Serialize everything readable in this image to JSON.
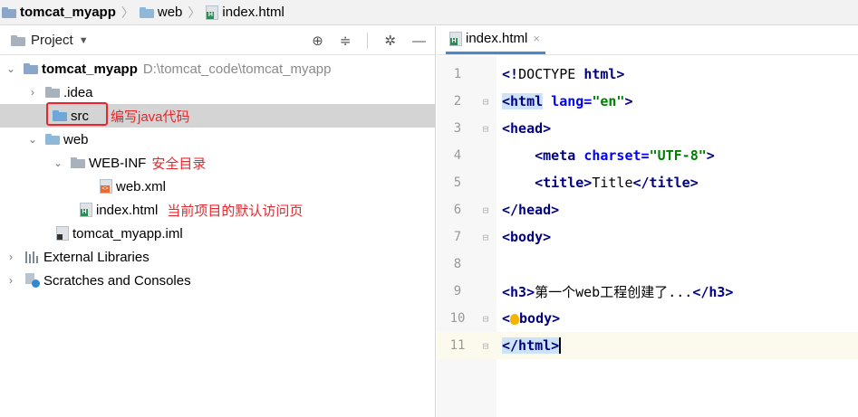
{
  "breadcrumb": {
    "project": "tomcat_myapp",
    "folder": "web",
    "file": "index.html"
  },
  "project_panel": {
    "title": "Project",
    "tree": [
      {
        "label": "tomcat_myapp",
        "path": "D:\\tomcat_code\\tomcat_myapp",
        "icon": "project-folder-icon",
        "expanded": true
      },
      {
        "label": ".idea",
        "icon": "folder-icon",
        "expanded": false
      },
      {
        "label": "src",
        "icon": "source-folder-icon",
        "annotation": "编写java代码",
        "selected": true
      },
      {
        "label": "web",
        "icon": "web-folder-icon",
        "expanded": true
      },
      {
        "label": "WEB-INF",
        "icon": "folder-icon",
        "annotation": "安全目录",
        "expanded": true
      },
      {
        "label": "web.xml",
        "icon": "xml-file-icon"
      },
      {
        "label": "index.html",
        "icon": "html-file-icon",
        "annotation": "当前项目的默认访问页"
      },
      {
        "label": "tomcat_myapp.iml",
        "icon": "iml-file-icon"
      },
      {
        "label": "External Libraries",
        "icon": "libraries-icon",
        "expanded": false
      },
      {
        "label": "Scratches and Consoles",
        "icon": "scratches-icon",
        "expanded": false
      }
    ]
  },
  "editor": {
    "tab_label": "index.html",
    "lines": [
      {
        "n": "1",
        "text": "<!DOCTYPE html>"
      },
      {
        "n": "2",
        "text": "<html lang=\"en\">"
      },
      {
        "n": "3",
        "text": "<head>"
      },
      {
        "n": "4",
        "text": "    <meta charset=\"UTF-8\">"
      },
      {
        "n": "5",
        "text": "    <title>Title</title>"
      },
      {
        "n": "6",
        "text": "</head>"
      },
      {
        "n": "7",
        "text": "<body>"
      },
      {
        "n": "8",
        "text": ""
      },
      {
        "n": "9",
        "text": "<h3>第一个web工程创建了...</h3>"
      },
      {
        "n": "10",
        "text": "</body>"
      },
      {
        "n": "11",
        "text": "</html>"
      }
    ]
  }
}
